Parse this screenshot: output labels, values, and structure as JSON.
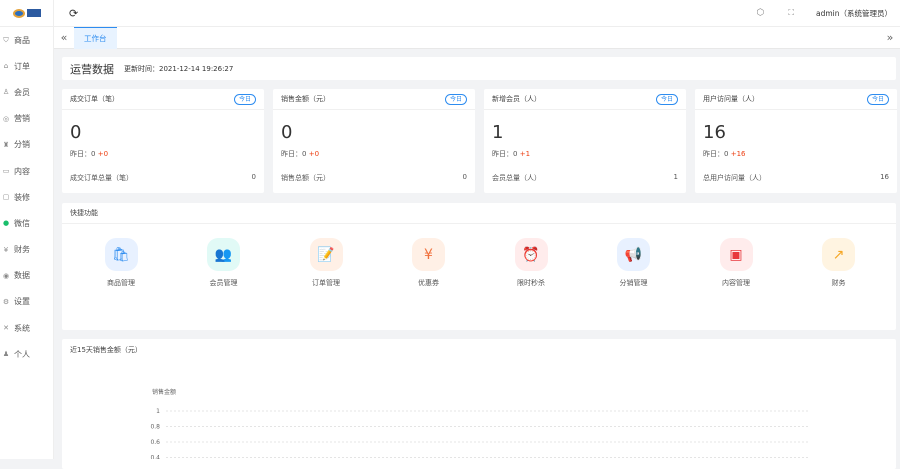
{
  "sidebar": {
    "items": [
      {
        "label": "商品",
        "icon": "cart-icon"
      },
      {
        "label": "订单",
        "icon": "order-icon"
      },
      {
        "label": "会员",
        "icon": "user-icon"
      },
      {
        "label": "营销",
        "icon": "marketing-icon"
      },
      {
        "label": "分销",
        "icon": "distribution-icon"
      },
      {
        "label": "内容",
        "icon": "content-icon"
      },
      {
        "label": "装修",
        "icon": "decorate-icon"
      },
      {
        "label": "微信",
        "icon": "wechat-icon"
      },
      {
        "label": "财务",
        "icon": "finance-icon"
      },
      {
        "label": "数据",
        "icon": "data-icon"
      },
      {
        "label": "设置",
        "icon": "settings-icon"
      },
      {
        "label": "系统",
        "icon": "system-icon"
      },
      {
        "label": "个人",
        "icon": "person-icon"
      }
    ]
  },
  "header": {
    "user": "admin（系统管理员）"
  },
  "tabs": {
    "active": "工作台"
  },
  "ops": {
    "title": "运营数据",
    "update_label": "更新时间：",
    "update_time": "2021-12-14 19:26:27"
  },
  "stats": [
    {
      "title": "成交订单（笔）",
      "badge": "今日",
      "value": "0",
      "yesterday_label": "昨日：",
      "yesterday": "0",
      "delta": "+0",
      "total_label": "成交订单总量（笔）",
      "total": "0"
    },
    {
      "title": "销售金额（元）",
      "badge": "今日",
      "value": "0",
      "yesterday_label": "昨日：",
      "yesterday": "0",
      "delta": "+0",
      "total_label": "销售总额（元）",
      "total": "0"
    },
    {
      "title": "新增会员（人）",
      "badge": "今日",
      "value": "1",
      "yesterday_label": "昨日：",
      "yesterday": "0",
      "delta": "+1",
      "total_label": "会员总量（人）",
      "total": "1"
    },
    {
      "title": "用户访问量（人）",
      "badge": "今日",
      "value": "16",
      "yesterday_label": "昨日：",
      "yesterday": "0",
      "delta": "+16",
      "total_label": "总用户访问量（人）",
      "total": "16"
    }
  ],
  "quick": {
    "title": "快捷功能",
    "items": [
      {
        "label": "商品管理",
        "glyph": "🛍",
        "bg": "#e8f1ff",
        "fg": "#2d8cf0"
      },
      {
        "label": "会员管理",
        "glyph": "👥",
        "bg": "#e1faf6",
        "fg": "#19c3a4"
      },
      {
        "label": "订单管理",
        "glyph": "📝",
        "bg": "#fff0e6",
        "fg": "#f08a3c"
      },
      {
        "label": "优惠券",
        "glyph": "¥",
        "bg": "#fff0e6",
        "fg": "#f0703c"
      },
      {
        "label": "限时秒杀",
        "glyph": "⏰",
        "bg": "#ffecec",
        "fg": "#ed4014"
      },
      {
        "label": "分销管理",
        "glyph": "📢",
        "bg": "#e8f1ff",
        "fg": "#4b7bf0"
      },
      {
        "label": "内容管理",
        "glyph": "▣",
        "bg": "#ffecec",
        "fg": "#e8383d"
      },
      {
        "label": "财务",
        "glyph": "↗",
        "bg": "#fff4e1",
        "fg": "#f5a623"
      }
    ]
  },
  "chart_data": {
    "type": "line",
    "title": "近15天销售金额（元）",
    "ylabel": "销售金额",
    "yticks": [
      "1",
      "0.8",
      "0.6",
      "0.4"
    ],
    "ylim": [
      0,
      1
    ],
    "series": []
  }
}
